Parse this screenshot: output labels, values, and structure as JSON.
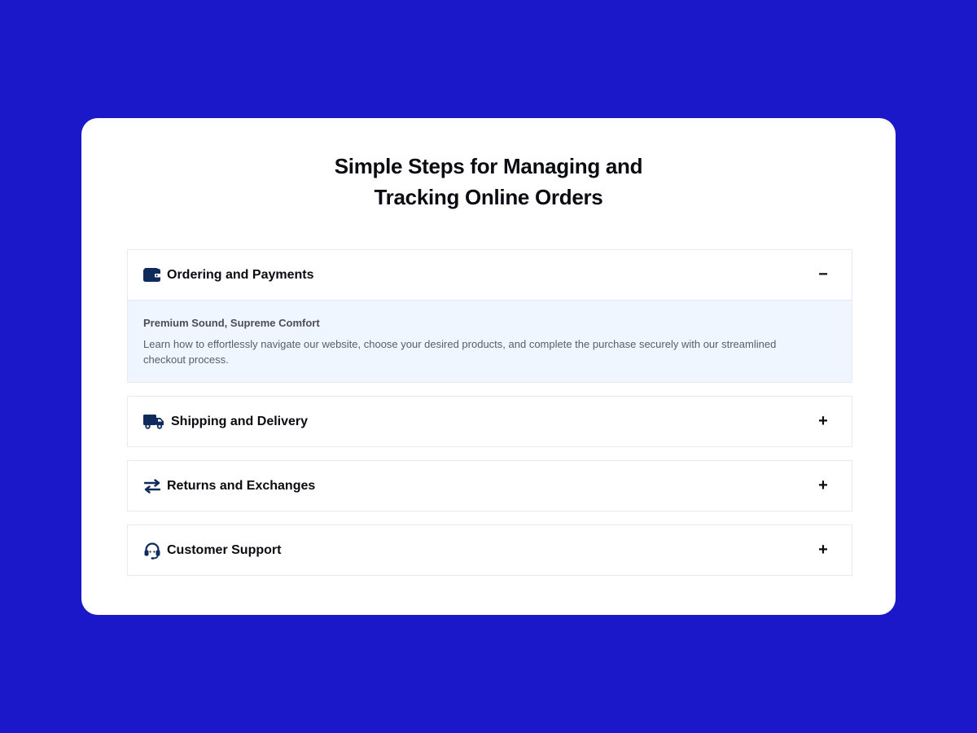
{
  "page": {
    "title_line1": "Simple Steps for Managing and",
    "title_line2": "Tracking Online Orders"
  },
  "colors": {
    "background": "#1a18c9",
    "card": "#ffffff",
    "icon": "#0f2b5b",
    "expanded_panel": "#eff6ff"
  },
  "accordion": {
    "items": [
      {
        "label": "Ordering and Payments",
        "icon": "wallet-icon",
        "toggle": "−",
        "expanded": true,
        "content_heading": "Premium Sound, Supreme Comfort",
        "content_text": "Learn how to effortlessly navigate our website, choose your desired products, and complete the purchase securely with our streamlined checkout process."
      },
      {
        "label": "Shipping and Delivery",
        "icon": "truck-icon",
        "toggle": "+",
        "expanded": false
      },
      {
        "label": "Returns and Exchanges",
        "icon": "exchange-arrows-icon",
        "toggle": "+",
        "expanded": false
      },
      {
        "label": "Customer Support",
        "icon": "headset-icon",
        "toggle": "+",
        "expanded": false
      }
    ]
  }
}
